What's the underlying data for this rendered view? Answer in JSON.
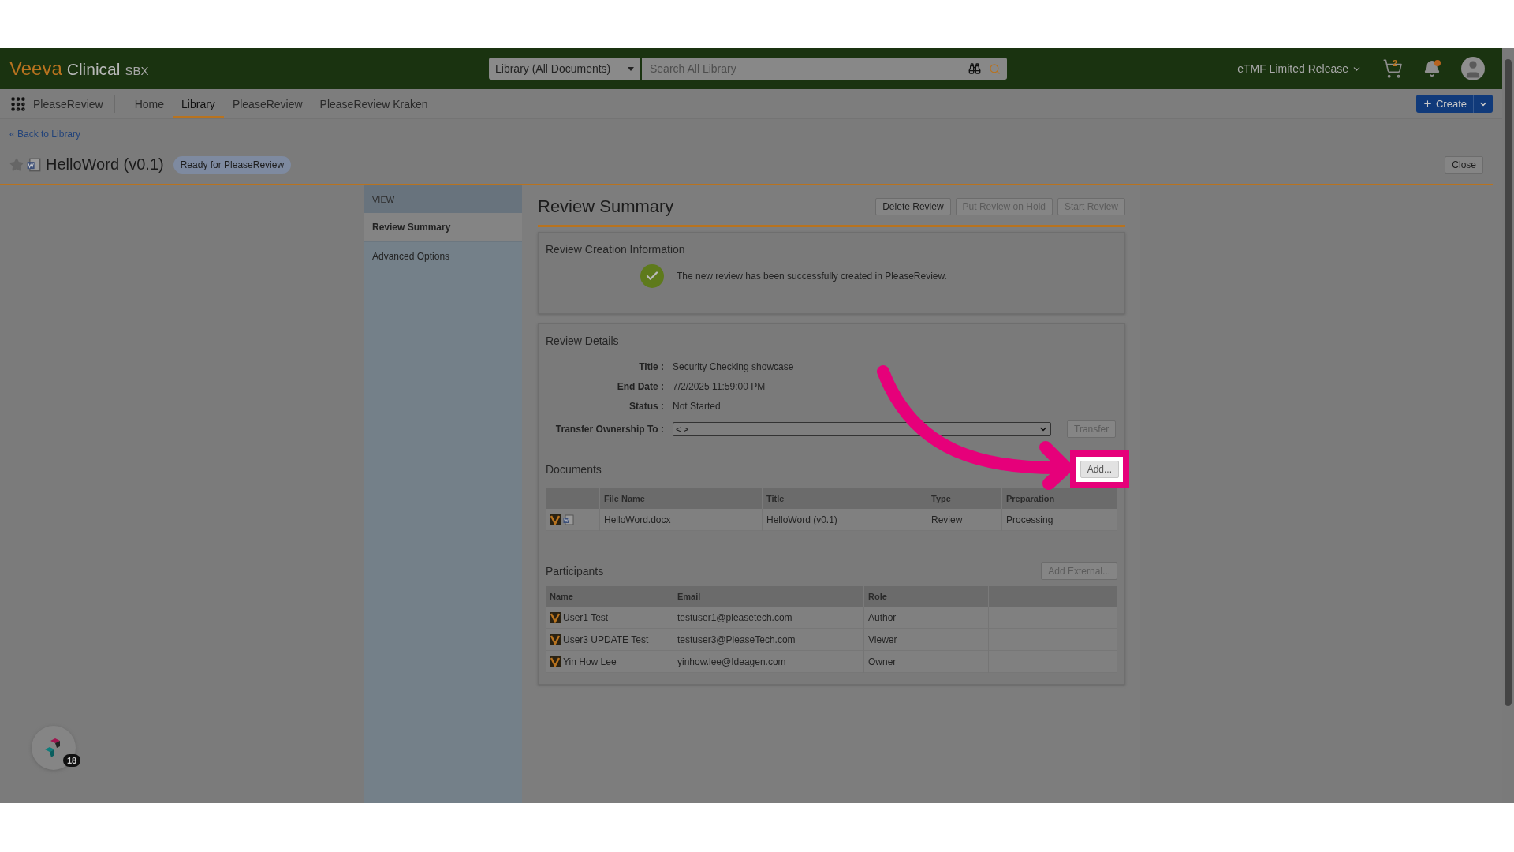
{
  "header": {
    "logo": {
      "brand": "Veeva",
      "product": "Clinical",
      "environment": "SBX"
    },
    "scope_select": "Library (All Documents)",
    "search": {
      "placeholder": "Search All Library"
    },
    "vault_menu": "eTMF Limited Release",
    "cart_count": "2",
    "unread_notifications": true
  },
  "nav": {
    "app": "PleaseReview",
    "tabs": [
      {
        "label": "Home",
        "selected": false
      },
      {
        "label": "Library",
        "selected": true
      },
      {
        "label": "PleaseReview",
        "selected": false
      },
      {
        "label": "PleaseReview Kraken",
        "selected": false
      }
    ],
    "create": "Create"
  },
  "back_link": "« Back to Library",
  "document": {
    "title": "HelloWord (v0.1)",
    "status": "Ready for PleaseReview",
    "favorite": false,
    "close": "Close"
  },
  "sidebar": {
    "heading": "VIEW",
    "items": [
      {
        "label": "Review Summary",
        "selected": true
      },
      {
        "label": "Advanced Options",
        "selected": false
      }
    ]
  },
  "summary": {
    "title": "Review Summary",
    "actions": [
      {
        "label": "Delete Review",
        "disabled": false
      },
      {
        "label": "Put Review on Hold",
        "disabled": true
      },
      {
        "label": "Start Review",
        "disabled": true
      }
    ],
    "creation": {
      "heading": "Review Creation Information",
      "message": "The new review has been successfully created in PleaseReview."
    },
    "details": {
      "heading": "Review Details",
      "fields": [
        {
          "label": "Title :",
          "value": "Security Checking showcase"
        },
        {
          "label": "End Date :",
          "value": "7/2/2025 11:59:00 PM"
        },
        {
          "label": "Status :",
          "value": "Not Started"
        }
      ],
      "transfer": {
        "label": "Transfer Ownership To :",
        "value": "< >",
        "button": "Transfer"
      }
    },
    "documents": {
      "heading": "Documents",
      "add": {
        "label": "Add...",
        "highlighted": true
      },
      "columns": [
        "File Name",
        "Title",
        "Type",
        "Preparation"
      ],
      "rows": [
        {
          "cells": [
            "HelloWord.docx",
            "HelloWord (v0.1)",
            "Review",
            "Processing"
          ]
        }
      ]
    },
    "participants": {
      "heading": "Participants",
      "add_external": "Add External...",
      "columns": [
        "Name",
        "Email",
        "Role"
      ],
      "rows": [
        {
          "cells": [
            "User1 Test",
            "testuser1@pleasetech.com",
            "Author"
          ]
        },
        {
          "cells": [
            "User3 UPDATE Test",
            "testuser3@PleaseTech.com",
            "Viewer"
          ]
        },
        {
          "cells": [
            "Yin How Lee",
            "yinhow.lee@Ideagen.com",
            "Owner"
          ]
        }
      ]
    }
  },
  "helper": {
    "count": "18"
  }
}
